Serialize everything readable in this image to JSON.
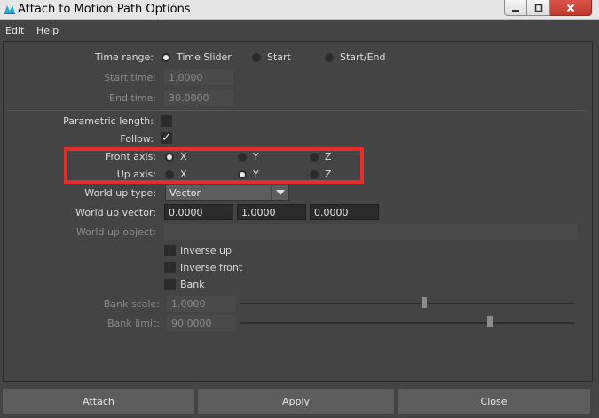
{
  "window": {
    "title": "Attach to Motion Path Options",
    "minimize_glyph": "—",
    "close_glyph": "✕",
    "colors": {
      "titlebar": "#e6e6e6",
      "close_button": "#c0392b"
    }
  },
  "menu": {
    "items": [
      "Edit",
      "Help"
    ]
  },
  "time_range": {
    "label": "Time range:",
    "options": [
      "Time Slider",
      "Start",
      "Start/End"
    ],
    "selected": "Time Slider"
  },
  "start_time": {
    "label": "Start time:",
    "value": "1.0000"
  },
  "end_time": {
    "label": "End time:",
    "value": "30.0000"
  },
  "parametric_length": {
    "label": "Parametric length:",
    "checked": false
  },
  "follow": {
    "label": "Follow:",
    "checked": true,
    "check_glyph": "✓"
  },
  "front_axis": {
    "label": "Front axis:",
    "options": [
      "X",
      "Y",
      "Z"
    ],
    "selected": "X"
  },
  "up_axis": {
    "label": "Up axis:",
    "options": [
      "X",
      "Y",
      "Z"
    ],
    "selected": "Y"
  },
  "world_up_type": {
    "label": "World up type:",
    "value": "Vector"
  },
  "world_up_vector": {
    "label": "World up vector:",
    "values": [
      "0.0000",
      "1.0000",
      "0.0000"
    ]
  },
  "world_up_object": {
    "label": "World up object:",
    "value": ""
  },
  "checkboxes": {
    "inverse_up": "Inverse up",
    "inverse_front": "Inverse front",
    "bank": "Bank"
  },
  "bank_scale": {
    "label": "Bank scale:",
    "value": "1.0000",
    "slider_fraction": 0.6
  },
  "bank_limit": {
    "label": "Bank limit:",
    "value": "90.0000",
    "slider_fraction": 0.77
  },
  "buttons": {
    "attach": "Attach",
    "apply": "Apply",
    "close": "Close"
  },
  "highlight_color": "#e52d2d"
}
